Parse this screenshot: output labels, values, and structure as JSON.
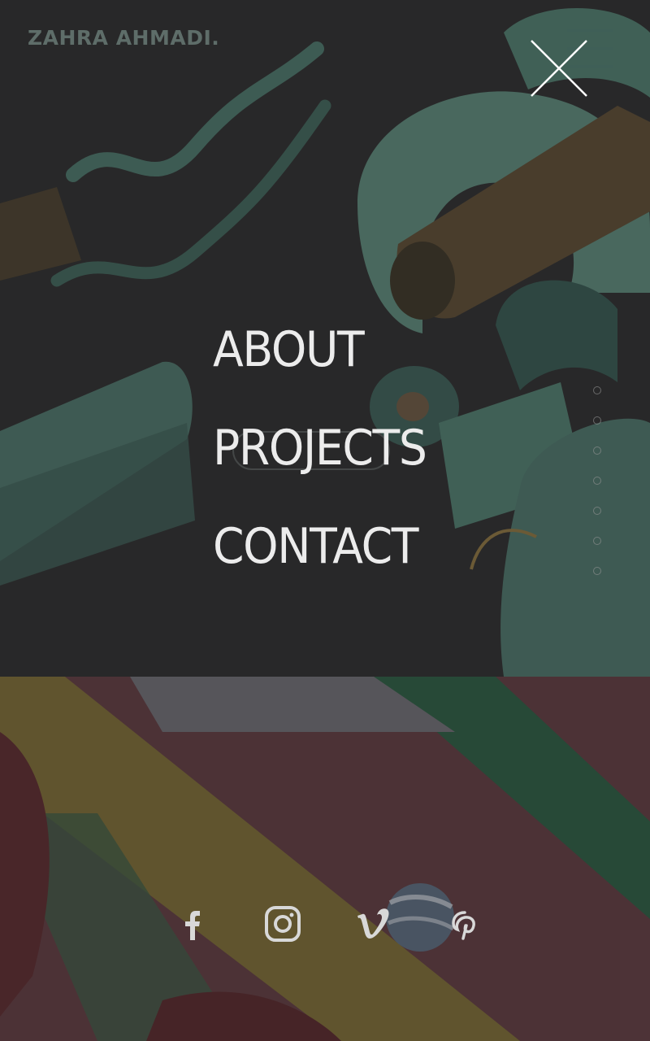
{
  "header": {
    "brand": "ZAHRA AHMADI."
  },
  "menu": {
    "items": [
      {
        "label": "ABOUT"
      },
      {
        "label": "PROJECTS"
      },
      {
        "label": "CONTACT"
      }
    ]
  },
  "pager": {
    "count": 7
  },
  "social": {
    "icons": [
      "facebook-icon",
      "instagram-icon",
      "vimeo-icon",
      "pinterest-icon"
    ]
  },
  "colors": {
    "menu_text": "#ececec",
    "brand_text": "#5e6d69",
    "accent_teal": "#4f7a6e"
  }
}
